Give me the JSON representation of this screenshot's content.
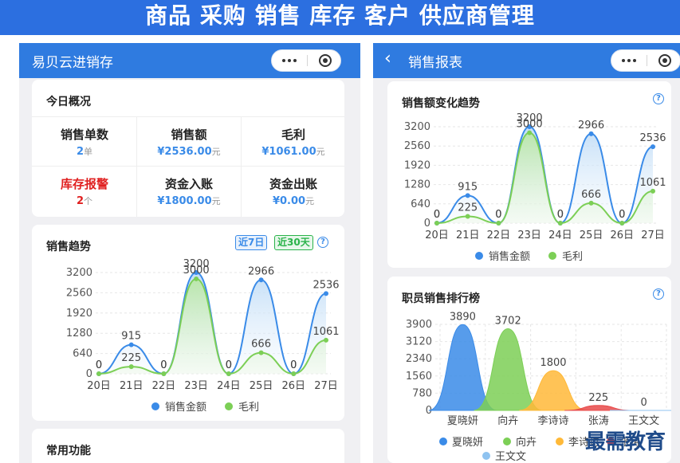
{
  "banner": {
    "text": "商品 采购 销售 库存 客户 供应商管理"
  },
  "left_phone": {
    "nav_title": "易贝云进销存",
    "overview": {
      "title": "今日概况",
      "stats": [
        {
          "label": "销售单数",
          "value": "2",
          "unit": "单",
          "alert": false
        },
        {
          "label": "销售额",
          "value": "¥2536.00",
          "unit": "元",
          "alert": false
        },
        {
          "label": "毛利",
          "value": "¥1061.00",
          "unit": "元",
          "alert": false
        },
        {
          "label": "库存报警",
          "value": "2",
          "unit": "个",
          "alert": true
        },
        {
          "label": "资金入账",
          "value": "¥1800.00",
          "unit": "元",
          "alert": false
        },
        {
          "label": "资金出账",
          "value": "¥0.00",
          "unit": "元",
          "alert": false
        }
      ]
    },
    "trend": {
      "title": "销售趋势",
      "btn_7": "近7日",
      "btn_30": "近30天",
      "help": "?"
    },
    "common": {
      "title": "常用功能"
    }
  },
  "right_phone": {
    "back_icon": "chevron-left-icon",
    "nav_title": "销售报表",
    "trend": {
      "title": "销售额变化趋势",
      "help": "?"
    },
    "ranking": {
      "title": "职员销售排行榜",
      "help": "?"
    }
  },
  "watermark": "最需教育",
  "colors": {
    "nav": "#2f7be0",
    "banner": "#2c6fe0",
    "blue": "#3a8be8",
    "green": "#7ccf56",
    "orange": "#ffb938",
    "red": "#e84a4a",
    "light_blue": "#8fc3f0",
    "alert": "#e02020"
  },
  "chart_data": [
    {
      "type": "line",
      "x": [
        "20日",
        "21日",
        "22日",
        "23日",
        "24日",
        "25日",
        "26日",
        "27日"
      ],
      "series": [
        {
          "name": "销售金额",
          "values": [
            0,
            915,
            0,
            3200,
            0,
            2966,
            0,
            2536
          ]
        },
        {
          "name": "毛利",
          "values": [
            0,
            225,
            0,
            3000,
            0,
            666,
            0,
            1061
          ]
        }
      ],
      "yticks": [
        0,
        640,
        1280,
        1920,
        2560,
        3200
      ],
      "ylim": [
        0,
        3200
      ],
      "legend": "bottom"
    },
    {
      "type": "line",
      "x": [
        "20日",
        "21日",
        "22日",
        "23日",
        "24日",
        "25日",
        "26日",
        "27日"
      ],
      "series": [
        {
          "name": "销售金额",
          "values": [
            0,
            915,
            0,
            3200,
            0,
            2966,
            0,
            2536
          ]
        },
        {
          "name": "毛利",
          "values": [
            0,
            225,
            0,
            3000,
            0,
            666,
            0,
            1061
          ]
        }
      ],
      "yticks": [
        0,
        640,
        1280,
        1920,
        2560,
        3200
      ],
      "ylim": [
        0,
        3200
      ],
      "legend": "bottom"
    },
    {
      "type": "area",
      "categories": [
        "夏晓妍",
        "向卉",
        "李诗诗",
        "张涛",
        "王文文"
      ],
      "values": [
        3890,
        3702,
        1800,
        225,
        0
      ],
      "yticks": [
        0,
        780,
        1560,
        2340,
        3120,
        3900
      ],
      "ylim": [
        0,
        3900
      ],
      "legend": "bottom"
    }
  ]
}
